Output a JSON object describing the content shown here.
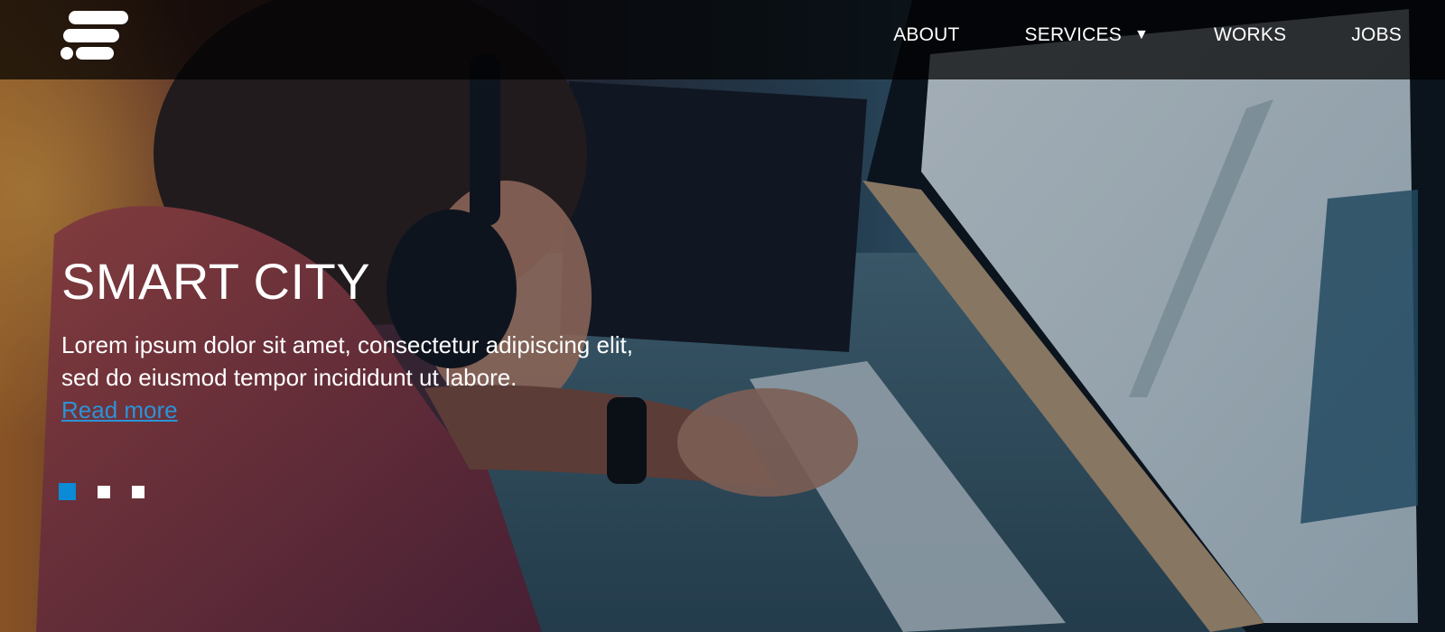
{
  "nav": {
    "items": [
      {
        "label": "ABOUT"
      },
      {
        "label": "SERVICES",
        "has_dropdown": true,
        "caret": "▼"
      },
      {
        "label": "WORKS"
      },
      {
        "label": "JOBS"
      }
    ]
  },
  "hero": {
    "title": "SMART CITY",
    "description": "Lorem ipsum dolor sit amet, consectetur adipiscing elit, sed do eiusmod tempor incididunt ut labore.",
    "read_more": "Read more",
    "slides": {
      "count": 3,
      "active_index": 0
    }
  },
  "colors": {
    "accent": "#0b8ad6",
    "link": "#2b93d8",
    "nav_bg": "#000000",
    "text": "#ffffff"
  },
  "icons": {
    "logo": "stacked-bars-logo-icon",
    "dropdown": "caret-down-icon"
  }
}
